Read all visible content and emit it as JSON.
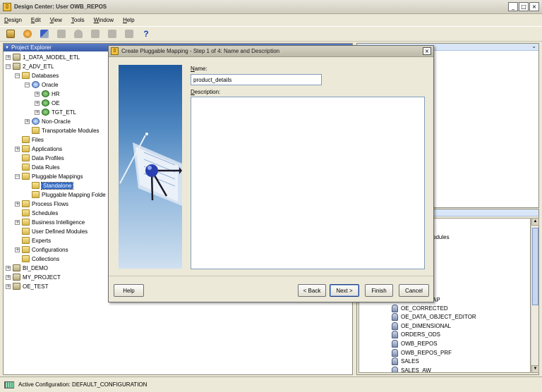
{
  "window": {
    "title": "Design Center: User OWB_REPOS"
  },
  "menu": [
    "Design",
    "Edit",
    "View",
    "Tools",
    "Window",
    "Help"
  ],
  "toolbar": {
    "help_glyph": "?"
  },
  "explorer": {
    "title": "Project Explorer",
    "items": [
      {
        "label": "1_DATA_MODEL_ETL",
        "icon": "project-icon",
        "expander": "+"
      },
      {
        "label": "2_ADV_ETL",
        "icon": "project-icon",
        "expander": "−"
      },
      {
        "label": "Databases",
        "icon": "folder-icon",
        "expander": "−"
      },
      {
        "label": "Oracle",
        "icon": "database-icon",
        "expander": "−"
      },
      {
        "label": "HR",
        "icon": "module-node-icon",
        "expander": "+"
      },
      {
        "label": "OE",
        "icon": "module-node-icon",
        "expander": "+"
      },
      {
        "label": "TGT_ETL",
        "icon": "module-node-icon",
        "expander": "+"
      },
      {
        "label": "Non-Oracle",
        "icon": "database-icon",
        "expander": "+"
      },
      {
        "label": "Transportable Modules",
        "icon": "folder-icon",
        "expander": ""
      },
      {
        "label": "Files",
        "icon": "folder-icon",
        "expander": ""
      },
      {
        "label": "Applications",
        "icon": "folder-icon",
        "expander": "+"
      },
      {
        "label": "Data Profiles",
        "icon": "folder-icon",
        "expander": ""
      },
      {
        "label": "Data Rules",
        "icon": "folder-icon",
        "expander": ""
      },
      {
        "label": "Pluggable Mappings",
        "icon": "folder-icon",
        "expander": "−"
      },
      {
        "label": "Standalone",
        "icon": "folder-icon",
        "expander": ""
      },
      {
        "label": "Pluggable Mapping Folde",
        "icon": "folder-icon",
        "expander": ""
      },
      {
        "label": "Process Flows",
        "icon": "folder-icon",
        "expander": "+"
      },
      {
        "label": "Schedules",
        "icon": "folder-icon",
        "expander": ""
      },
      {
        "label": "Business Intelligence",
        "icon": "folder-icon",
        "expander": "+"
      },
      {
        "label": "User Defined Modules",
        "icon": "folder-icon",
        "expander": ""
      },
      {
        "label": "Experts",
        "icon": "folder-icon",
        "expander": ""
      },
      {
        "label": "Configurations",
        "icon": "folder-icon",
        "expander": "+"
      },
      {
        "label": "Collections",
        "icon": "folder-icon",
        "expander": ""
      },
      {
        "label": "BI_DEMO",
        "icon": "project-icon",
        "expander": "+"
      },
      {
        "label": "MY_PROJECT",
        "icon": "project-icon",
        "expander": "+"
      },
      {
        "label": "OE_TEST",
        "icon": "project-icon",
        "expander": "+"
      }
    ]
  },
  "right_bottom": {
    "partial_items": [
      "odules",
      "AP"
    ],
    "items": [
      "OE_CORRECTED",
      "OE_DATA_OBJECT_EDITOR",
      "OE_DIMENSIONAL",
      "ORDERS_ODS",
      "OWB_REPOS",
      "OWB_REPOS_PRF",
      "SALES",
      "SALES_AW"
    ]
  },
  "dialog": {
    "title": "Create Pluggable Mapping - Step 1 of 4: Name and Description",
    "name_label": "Name:",
    "name_value": "product_details",
    "description_label": "Description:",
    "buttons": {
      "help": "Help",
      "back": "< Back",
      "next": "Next >",
      "finish": "Finish",
      "cancel": "Cancel"
    }
  },
  "status": {
    "text": "Active Configuration: DEFAULT_CONFIGURATION"
  },
  "colors": {
    "selection": "#3169c6",
    "accent_blue": "#1f5aa0"
  }
}
